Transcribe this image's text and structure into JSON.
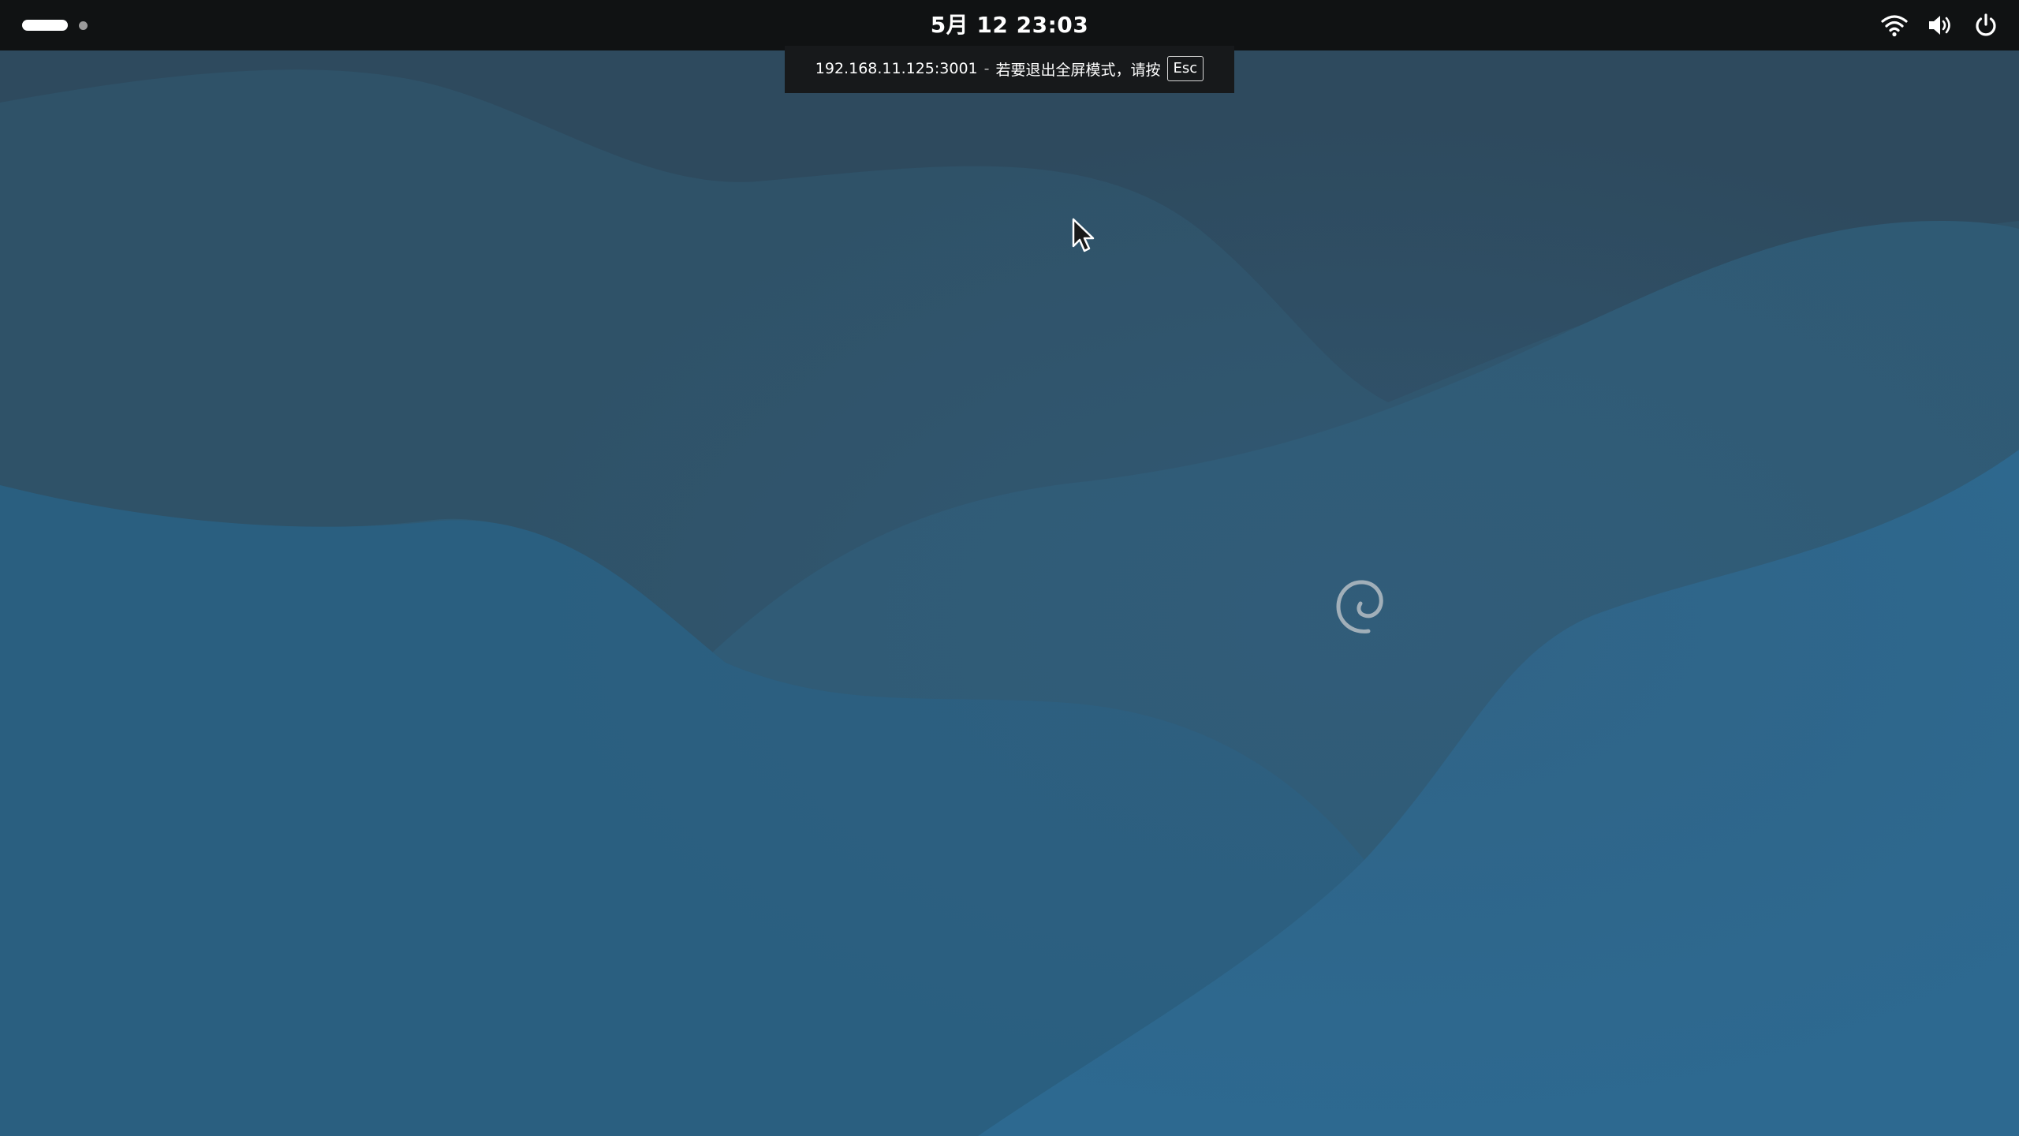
{
  "topbar": {
    "clock": "5月 12  23:03",
    "workspaces": [
      "workspace-1",
      "workspace-2"
    ],
    "tray_icons": [
      "wifi-icon",
      "volume-icon",
      "power-icon"
    ]
  },
  "fullscreen_notice": {
    "address": "192.168.11.125:3001",
    "separator": "-",
    "message": "若要退出全屏模式，请按",
    "key": "Esc"
  },
  "desktop": {
    "logo": "debian-swirl-icon",
    "colors": {
      "topbar": "#101213",
      "wallpaper_dark": "#2c4a5f",
      "wallpaper_light": "#2c6690"
    }
  }
}
